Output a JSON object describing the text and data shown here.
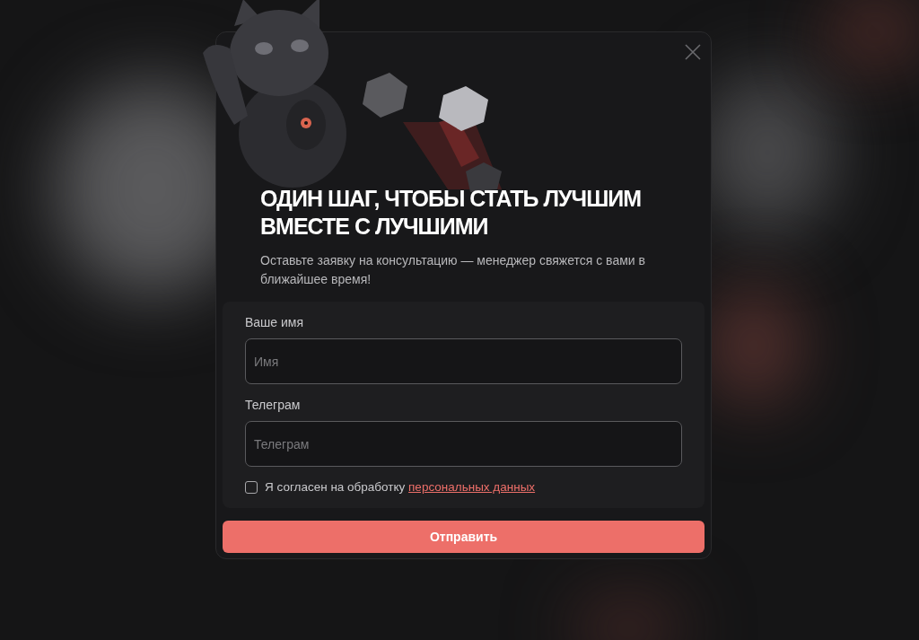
{
  "dialog": {
    "title": "ОДИН ШАГ, ЧТОБЫ СТАТЬ ЛУЧШИМ ВМЕСТЕ С ЛУЧШИМИ",
    "subtitle": "Оставьте заявку на консультацию — менеджер свяжется с вами в ближайшее время!",
    "fields": [
      {
        "label": "Ваше имя",
        "placeholder": "Имя"
      },
      {
        "label": "Телеграм",
        "placeholder": "Телеграм"
      }
    ],
    "consent": {
      "text": "Я согласен на обработку",
      "link": "персональных данных",
      "checked": false
    },
    "submit": "Отправить"
  }
}
